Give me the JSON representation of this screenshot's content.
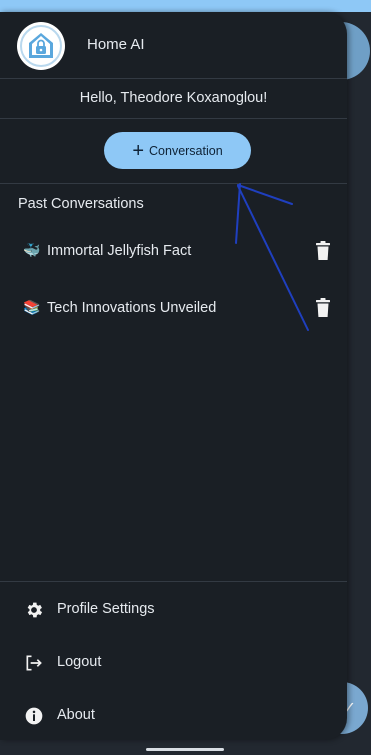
{
  "app": {
    "title": "Home AI",
    "logo_icon": "house-lock-icon"
  },
  "drawer": {
    "greeting": "Hello, Theodore Koxanoglou!",
    "new_conversation_button": {
      "plus": "+",
      "label": "Conversation"
    },
    "past_conversations_title": "Past Conversations",
    "conversations": [
      {
        "emoji": "🐳",
        "title": "Immortal Jellyfish Fact",
        "delete_icon": "trash-icon"
      },
      {
        "emoji": "📚",
        "title": "Tech Innovations Unveiled",
        "delete_icon": "trash-icon"
      }
    ],
    "footer": [
      {
        "label": "Profile Settings",
        "icon": "gear-icon"
      },
      {
        "label": "Logout",
        "icon": "logout-icon"
      },
      {
        "label": "About",
        "icon": "info-icon"
      }
    ]
  },
  "background": {
    "fab_bottom_glyph": "✓"
  },
  "colors": {
    "accent": "#8ec8f6",
    "drawer_bg": "#1a1f25",
    "annotation_arrow": "#1f3fbf"
  }
}
